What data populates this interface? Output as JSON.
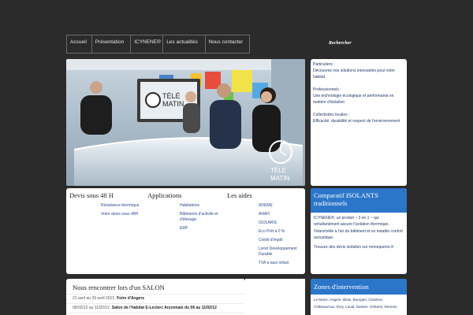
{
  "nav": {
    "items": [
      "Accueil",
      "Présentation",
      "ICYNENE®",
      "Les actualités",
      "Nous contacter"
    ]
  },
  "search": {
    "label": "Rechercher"
  },
  "hero": {
    "logo_line1": "TELE",
    "logo_line2": "MATIN"
  },
  "info": {
    "particuliers_title": "Particuliers :",
    "particuliers_text": "Découvrez nos solutions innovantes pour votre habitat",
    "professionnels_title": "Professionnels :",
    "professionnels_text": "Une technologie écologique et performante en matière d'isolation",
    "collectivites_title": "Collectivités locales :",
    "collectivites_text": "Efficacité, durabilité et respect de l'environnement"
  },
  "columns": {
    "devis": {
      "title": "Devis sous 48 H",
      "items": [
        "Résistance thermique",
        "Votre devis sous 48H"
      ]
    },
    "applications": {
      "title": "Applications",
      "items": [
        "Habitations",
        "Bâtiments d'activité et d'élevage",
        "ERP"
      ]
    },
    "aides": {
      "title": "Les aides",
      "items": [
        "ADEME",
        "ANAH",
        "ISOLARIS",
        "Eco Prêt à 0 %",
        "Crédit d'impôt",
        "Livret Développement Durable",
        "TVA à taux réduit"
      ]
    }
  },
  "comparatif": {
    "title": "Comparatif ISOLANTS traditionnels",
    "text1": "ICYNENE®, un produit – 3 en 1 – qui simultanément assure l'isolation thermique, l'étanchéité à l'air du bâtiment et un notable confort acoustique.",
    "text2": "Trouvez des devis isolation sur monequerre.fr"
  },
  "salon": {
    "title": "Nous rencontrer lors d'un SALON",
    "rows": [
      {
        "date": "21 avril au 29 avril 2013",
        "event": "Foire d'Angers"
      },
      {
        "date": "06/02/12 au 11/02/12",
        "event": "Salon de l'habitat E-Leclerc Arçonnais du 06 au 11/02/12"
      }
    ]
  },
  "zones": {
    "title": "Zones d'intervention",
    "text": "Le Mans, Angers, Blois, Bourges, Chartres, Châteauroux, Évry, Laval, Nantes, Orléans, Rennes,"
  }
}
